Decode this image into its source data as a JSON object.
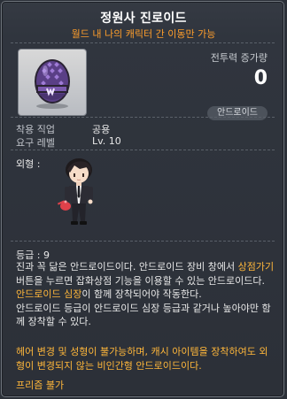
{
  "title": "정원사 진로이드",
  "subtitle": "월드 내 나의 캐릭터 간 이동만 가능",
  "power": {
    "label": "전투력 증가량",
    "value": "0"
  },
  "badge": "안드로이드",
  "stats": [
    {
      "label": "착용 직업",
      "value": "공용"
    },
    {
      "label": "요구 레벨",
      "value": "Lv. 10"
    }
  ],
  "look_label": "외형 :",
  "grade": "등급 : 9",
  "description": {
    "p1": "진과 꼭 닮은 안드로이드이다. 안드로이드 장비 창에서 ",
    "hl1": "상점가기",
    "p2": " 버튼을 누르면 잡화상점 기능을 이용할 수 있는 안드로이드다. ",
    "hl2": "안드로이드 심장",
    "p3": "이 함께 장착되어야 작동한다.",
    "p4": "안드로이드 등급이 안드로이드 심장 등급과 같거나 높아야만 함께 장착할 수 있다."
  },
  "warning": "헤어 변경 및 성형이 불가능하며, 캐시 아이템을 장착하여도 외형이 변경되지 않는 비인간형 안드로이드이다.",
  "prism": "프리즘 불가",
  "colors": {
    "accent_orange": "#ffb73a",
    "subtitle_orange": "#ff9e2b",
    "background": "#2f343c"
  }
}
